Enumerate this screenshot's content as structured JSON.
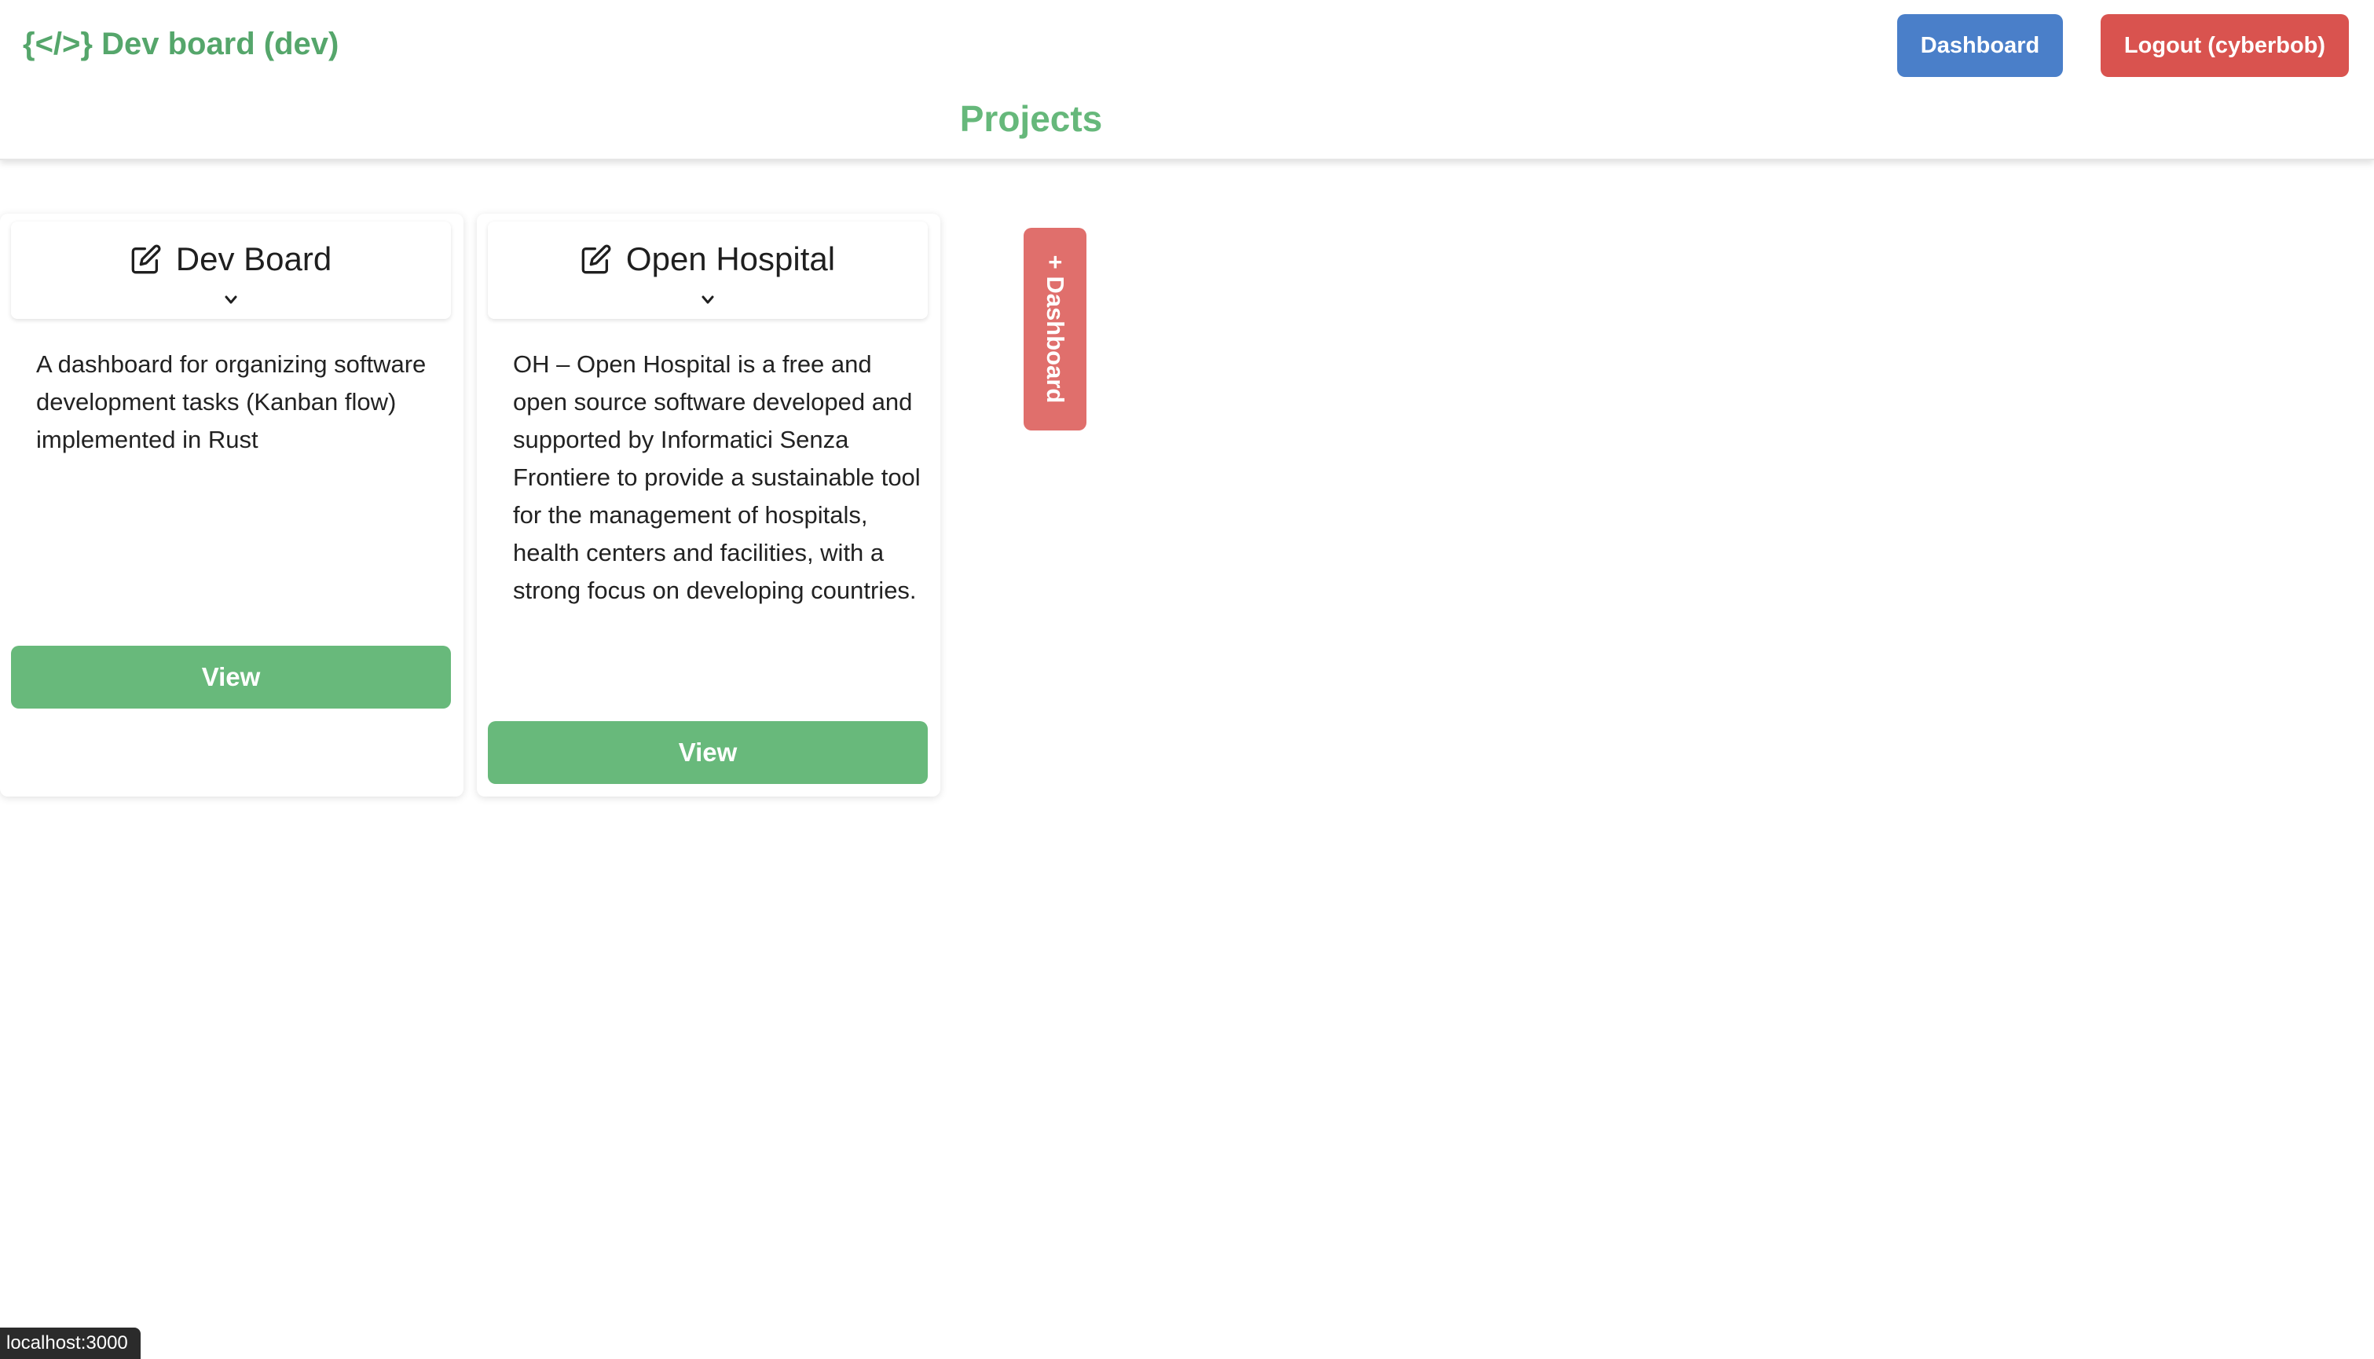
{
  "header": {
    "brand": "{</>} Dev board (dev)",
    "dashboard_button": "Dashboard",
    "logout_button": "Logout (cyberbob)",
    "page_title": "Projects"
  },
  "projects": [
    {
      "title": "Dev Board",
      "description": "A dashboard for organizing software development tasks (Kanban flow) implemented in Rust",
      "view_label": "View"
    },
    {
      "title": "Open Hospital",
      "description": "OH – Open Hospital is a free and open source software developed and supported by Informatici Senza Frontiere to provide a sustainable tool for the management of hospitals, health centers and facilities, with a strong focus on developing countries.",
      "view_label": "View"
    }
  ],
  "add_dashboard_label": "+ Dashboard",
  "status_bar": {
    "url": "localhost:3000"
  },
  "colors": {
    "brand_green": "#55a66b",
    "view_green": "#68b97b",
    "dashboard_blue": "#4a7fc9",
    "logout_red": "#d9534f",
    "add_red": "#e06f6c"
  }
}
